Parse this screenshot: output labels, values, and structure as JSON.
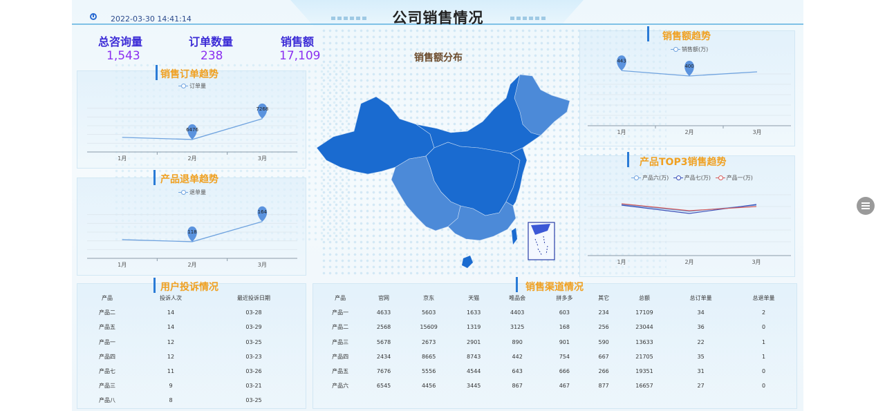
{
  "header": {
    "title": "公司销售情况",
    "datetime": "2022-03-30 14:41:14"
  },
  "kpis": [
    {
      "label": "总咨询量",
      "value": "1,543"
    },
    {
      "label": "订单数量",
      "value": "238"
    },
    {
      "label": "销售额",
      "value": "17,109"
    }
  ],
  "map": {
    "title": "销售额分布"
  },
  "order_trend": {
    "title": "销售订单趋势",
    "legend": "订单量"
  },
  "refund_trend": {
    "title": "产品退单趋势",
    "legend": "退单量"
  },
  "sales_trend": {
    "title": "销售额趋势",
    "legend": "销售额(万)"
  },
  "top3_trend": {
    "title": "产品TOP3销售趋势",
    "legend": [
      "产品六(万)",
      "产品七(万)",
      "产品一(万)"
    ]
  },
  "chart_data": [
    {
      "type": "line",
      "title": "销售订单趋势",
      "x": [
        "1月",
        "2月",
        "3月"
      ],
      "series": [
        {
          "name": "订单量",
          "values": [
            null,
            6476,
            7268
          ]
        }
      ],
      "point_labels": [
        "6476",
        "7268"
      ],
      "grid": true
    },
    {
      "type": "line",
      "title": "产品退单趋势",
      "x": [
        "1月",
        "2月",
        "3月"
      ],
      "series": [
        {
          "name": "退单量",
          "values": [
            null,
            118,
            164
          ]
        }
      ],
      "point_labels": [
        "118",
        "164"
      ],
      "grid": true
    },
    {
      "type": "line",
      "title": "销售额趋势",
      "x": [
        "1月",
        "2月",
        "3月"
      ],
      "series": [
        {
          "name": "销售额(万)",
          "values": [
            443,
            400,
            null
          ]
        }
      ],
      "point_labels": [
        "443",
        "400"
      ],
      "grid": true
    },
    {
      "type": "line",
      "title": "产品TOP3销售趋势",
      "x": [
        "1月",
        "2月",
        "3月"
      ],
      "series": [
        {
          "name": "产品六(万)",
          "values": [
            null,
            null,
            null
          ]
        },
        {
          "name": "产品七(万)",
          "values": [
            null,
            null,
            null
          ]
        },
        {
          "name": "产品一(万)",
          "values": [
            null,
            null,
            null
          ]
        }
      ],
      "grid": true
    }
  ],
  "complaints": {
    "title": "用户投诉情况",
    "columns": [
      "产品",
      "投诉人次",
      "最近投诉日期"
    ],
    "rows": [
      [
        "产品二",
        "14",
        "03-28"
      ],
      [
        "产品五",
        "14",
        "03-29"
      ],
      [
        "产品一",
        "12",
        "03-25"
      ],
      [
        "产品四",
        "12",
        "03-23"
      ],
      [
        "产品七",
        "11",
        "03-26"
      ],
      [
        "产品三",
        "9",
        "03-21"
      ],
      [
        "产品八",
        "8",
        "03-25"
      ]
    ]
  },
  "channels": {
    "title": "销售渠道情况",
    "columns": [
      "产品",
      "官网",
      "京东",
      "天猫",
      "唯品会",
      "拼多多",
      "其它",
      "总额",
      "总订单量",
      "总退单量"
    ],
    "rows": [
      [
        "产品一",
        "4633",
        "5603",
        "1633",
        "4403",
        "603",
        "234",
        "17109",
        "34",
        "2"
      ],
      [
        "产品二",
        "2568",
        "15609",
        "1319",
        "3125",
        "168",
        "256",
        "23044",
        "36",
        "0"
      ],
      [
        "产品三",
        "5678",
        "2673",
        "2901",
        "890",
        "901",
        "590",
        "13633",
        "22",
        "1"
      ],
      [
        "产品四",
        "2434",
        "8665",
        "8743",
        "442",
        "754",
        "667",
        "21705",
        "35",
        "1"
      ],
      [
        "产品五",
        "7676",
        "5556",
        "4544",
        "643",
        "666",
        "266",
        "19351",
        "31",
        "0"
      ],
      [
        "产品六",
        "6545",
        "4456",
        "3445",
        "867",
        "467",
        "877",
        "16657",
        "27",
        "0"
      ]
    ]
  },
  "colors": {
    "accent": "#f0a020",
    "kpi_label": "#3b2bd6",
    "kpi_value": "#8b2ff0",
    "line": "#6fa3df",
    "map_dark": "#1a6bd0",
    "map_light": "#4c8ad8"
  }
}
